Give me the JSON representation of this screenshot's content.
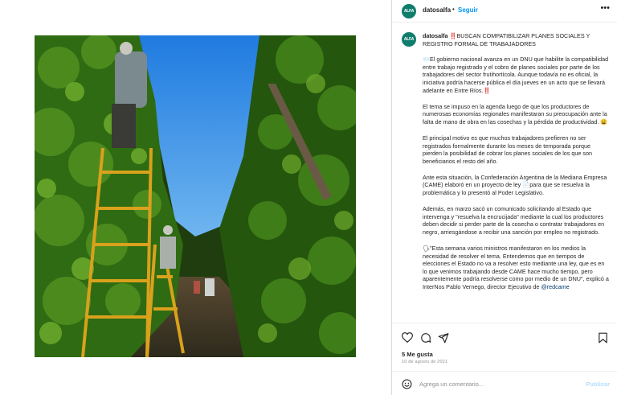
{
  "post": {
    "username": "datosalfa",
    "avatar_text": "ALFA",
    "follow_label": "Seguir",
    "dot": "•",
    "more": "•••"
  },
  "caption": {
    "title": "‼️BUSCAN COMPATIBILIZAR PLANES SOCIALES Y REGISTRO FORMAL DE TRABAJADORES",
    "paragraphs": [
      "📨El gobierno nacional avanza en un DNU que habilite la compatibilidad entre trabajo registrado y el cobro de planes sociales por parte de los trabajadores del sector frutihortícola. Aunque todavía no es oficial, la iniciativa podría hacerse pública el día jueves en un acto que se llevará adelante en Entre Ríos.‼️",
      "El tema se impuso en la agenda luego de que los productores de numerosas economías regionales manifestaran su preocupación ante la falta de mano de obra en las cosechas y la pérdida de productividad. 😩",
      "El principal motivo es que muchos trabajadores prefieren no ser registrados formalmente durante los meses de temporada porque pierden la posibilidad de cobrar los planes sociales de los que son beneficiarios el resto del año.",
      "Ante esta situación, la Confederación Argentina de la Mediana Empresa (CAME) elaboró en un proyecto de ley 📄para que se resuelva la problemática y lo presentó al Poder Legislativo.",
      "Además, en marzo sacó un comunicado solicitando al Estado que intervenga y \"resuelva la encrucijada\" mediante la cual los productores deben decidir si perder parte de la cosecha o contratar trabajadores en negro, arriesgándose a recibir una sanción por empleo no registrado."
    ],
    "last_paragraph": "🗣\"Esta semana varios ministros manifestaron en los medios la necesidad de resolver el tema. Entendemos que en tiempos de elecciones el Estado no va a resolver esto mediante una ley, que es en lo que venimos trabajando desde CAME hace mucho tiempo, pero aparentemente podría resolverse como por medio de un DNU\", explicó a InterNos Pablo Vernego, director Ejecutivo de ",
    "mention": "@redcame"
  },
  "engagement": {
    "likes": "5 Me gusta",
    "date": "10 de agosto de 2021"
  },
  "comment": {
    "placeholder": "Agrega un comentario...",
    "publish_label": "Publicar"
  },
  "colors": {
    "accent": "#0095f6",
    "avatar_bg": "#0f7d6c",
    "sky": "#2a86e8",
    "foliage": "#2f6b12",
    "ladder": "#d9a11c"
  },
  "icons": [
    "more-icon",
    "heart-icon",
    "comment-icon",
    "share-icon",
    "bookmark-icon",
    "emoji-icon"
  ]
}
